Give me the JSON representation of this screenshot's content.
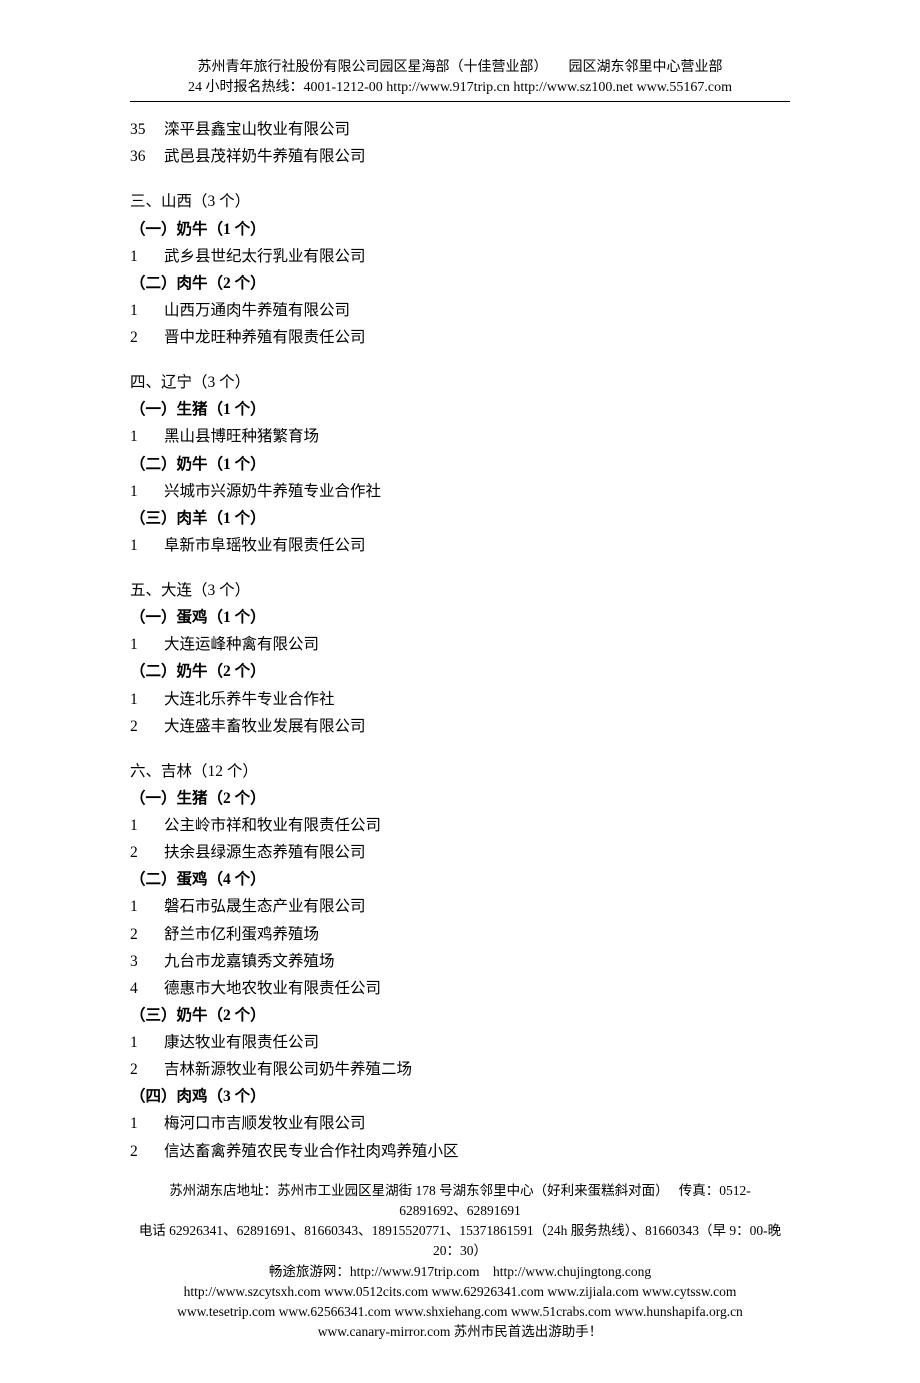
{
  "header": {
    "line1": "苏州青年旅行社股份有限公司园区星海部（十佳营业部）　　园区湖东邻里中心营业部",
    "line2": "24 小时报名热线：4001-1212-00 http://www.917trip.cn http://www.sz100.net www.55167.com"
  },
  "top_items": [
    {
      "num": "35",
      "name": "滦平县鑫宝山牧业有限公司"
    },
    {
      "num": "36",
      "name": "武邑县茂祥奶牛养殖有限公司"
    }
  ],
  "sections": [
    {
      "title": "三、山西（3 个）",
      "subs": [
        {
          "title": "（一）奶牛（1 个）",
          "items": [
            {
              "num": "1",
              "name": "武乡县世纪太行乳业有限公司"
            }
          ]
        },
        {
          "title": "（二）肉牛（2 个）",
          "items": [
            {
              "num": "1",
              "name": "山西万通肉牛养殖有限公司"
            },
            {
              "num": "2",
              "name": "晋中龙旺种养殖有限责任公司"
            }
          ]
        }
      ]
    },
    {
      "title": "四、辽宁（3 个）",
      "subs": [
        {
          "title": "（一）生猪（1 个）",
          "items": [
            {
              "num": "1",
              "name": "黑山县博旺种猪繁育场"
            }
          ]
        },
        {
          "title": "（二）奶牛（1 个）",
          "items": [
            {
              "num": "1",
              "name": "兴城市兴源奶牛养殖专业合作社"
            }
          ]
        },
        {
          "title": "（三）肉羊（1 个）",
          "items": [
            {
              "num": "1",
              "name": "阜新市阜瑶牧业有限责任公司"
            }
          ]
        }
      ]
    },
    {
      "title": "五、大连（3 个）",
      "subs": [
        {
          "title": "（一）蛋鸡（1 个）",
          "items": [
            {
              "num": "1",
              "name": "大连运峰种禽有限公司"
            }
          ]
        },
        {
          "title": "（二）奶牛（2 个）",
          "items": [
            {
              "num": "1",
              "name": "大连北乐养牛专业合作社"
            },
            {
              "num": "2",
              "name": "大连盛丰畜牧业发展有限公司"
            }
          ]
        }
      ]
    },
    {
      "title": "六、吉林（12 个）",
      "subs": [
        {
          "title": "（一）生猪（2 个）",
          "items": [
            {
              "num": "1",
              "name": "公主岭市祥和牧业有限责任公司"
            },
            {
              "num": "2",
              "name": "扶余县绿源生态养殖有限公司"
            }
          ]
        },
        {
          "title": "（二）蛋鸡（4 个）",
          "items": [
            {
              "num": "1",
              "name": "磐石市弘晟生态产业有限公司"
            },
            {
              "num": "2",
              "name": "舒兰市亿利蛋鸡养殖场"
            },
            {
              "num": "3",
              "name": "九台市龙嘉镇秀文养殖场"
            },
            {
              "num": "4",
              "name": "德惠市大地农牧业有限责任公司"
            }
          ]
        },
        {
          "title": "（三）奶牛（2 个）",
          "items": [
            {
              "num": "1",
              "name": "康达牧业有限责任公司"
            },
            {
              "num": "2",
              "name": "吉林新源牧业有限公司奶牛养殖二场"
            }
          ]
        },
        {
          "title": "（四）肉鸡（3 个）",
          "items": [
            {
              "num": "1",
              "name": "梅河口市吉顺发牧业有限公司"
            },
            {
              "num": "2",
              "name": "信达畜禽养殖农民专业合作社肉鸡养殖小区"
            }
          ]
        }
      ]
    }
  ],
  "footer": {
    "lines": [
      "苏州湖东店地址：苏州市工业园区星湖街 178 号湖东邻里中心（好利来蛋糕斜对面）　 传真：0512-62891692、62891691",
      "电话 62926341、62891691、81660343、18915520771、15371861591（24h 服务热线）、81660343（早 9：00-晚 20：30）",
      "畅途旅游网：http://www.917trip.com　http://www.chujingtong.cong",
      "http://www.szcytsxh.com www.0512cits.com www.62926341.com www.zijiala.com www.cytssw.com",
      "www.tesetrip.com www.62566341.com www.shxiehang.com www.51crabs.com www.hunshapifa.org.cn",
      "www.canary-mirror.com 苏州市民首选出游助手！"
    ]
  }
}
